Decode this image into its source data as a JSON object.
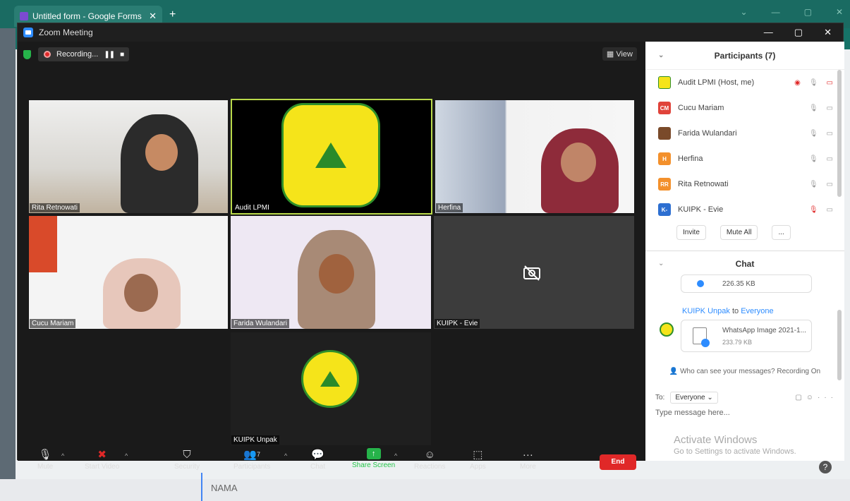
{
  "browser": {
    "tab_title": "Untitled form - Google Forms",
    "close": "✕",
    "new_tab": "+"
  },
  "form": {
    "field_label": "NAMA",
    "help": "?"
  },
  "zoom": {
    "title": "Zoom Meeting",
    "recording_label": "Recording...",
    "view_label": "View",
    "tiles": [
      {
        "name": "Rita Retnowati"
      },
      {
        "name": "Audit LPMI"
      },
      {
        "name": "Herfina"
      },
      {
        "name": "Cucu Mariam"
      },
      {
        "name": "Farida Wulandari"
      },
      {
        "name": "KUIPK - Evie"
      },
      {
        "name": "KUIPK Unpak"
      }
    ],
    "toolbar": {
      "mute": "Mute",
      "start_video": "Start Video",
      "security": "Security",
      "participants": "Participants",
      "participants_count": "7",
      "chat": "Chat",
      "share_screen": "Share Screen",
      "reactions": "Reactions",
      "apps": "Apps",
      "more": "More",
      "end": "End"
    }
  },
  "participants_panel": {
    "title": "Participants (7)",
    "participants": [
      {
        "name": "Audit LPMI (Host, me)",
        "initials": "",
        "color": "#f5e41a"
      },
      {
        "name": "Cucu Mariam",
        "initials": "CM",
        "color": "#e0433a"
      },
      {
        "name": "Farida Wulandari",
        "initials": "",
        "color": "#7a4a2a"
      },
      {
        "name": "Herfina",
        "initials": "H",
        "color": "#f3902b"
      },
      {
        "name": "Rita Retnowati",
        "initials": "RR",
        "color": "#f3902b"
      },
      {
        "name": "KUIPK - Evie",
        "initials": "K-",
        "color": "#2d6fd1"
      }
    ],
    "invite": "Invite",
    "mute_all": "Mute All",
    "more": "..."
  },
  "chat_panel": {
    "title": "Chat",
    "file1_size": "226.35 KB",
    "sender": "KUIPK Unpak",
    "to_text": "to",
    "recipient": "Everyone",
    "file2_name": "WhatsApp Image 2021-1...",
    "file2_size": "233.79 KB",
    "notice": "Who can see your messages? Recording On",
    "to_label": "To:",
    "to_value": "Everyone",
    "placeholder": "Type message here..."
  },
  "watermark": {
    "line1": "Activate Windows",
    "line2": "Go to Settings to activate Windows."
  }
}
